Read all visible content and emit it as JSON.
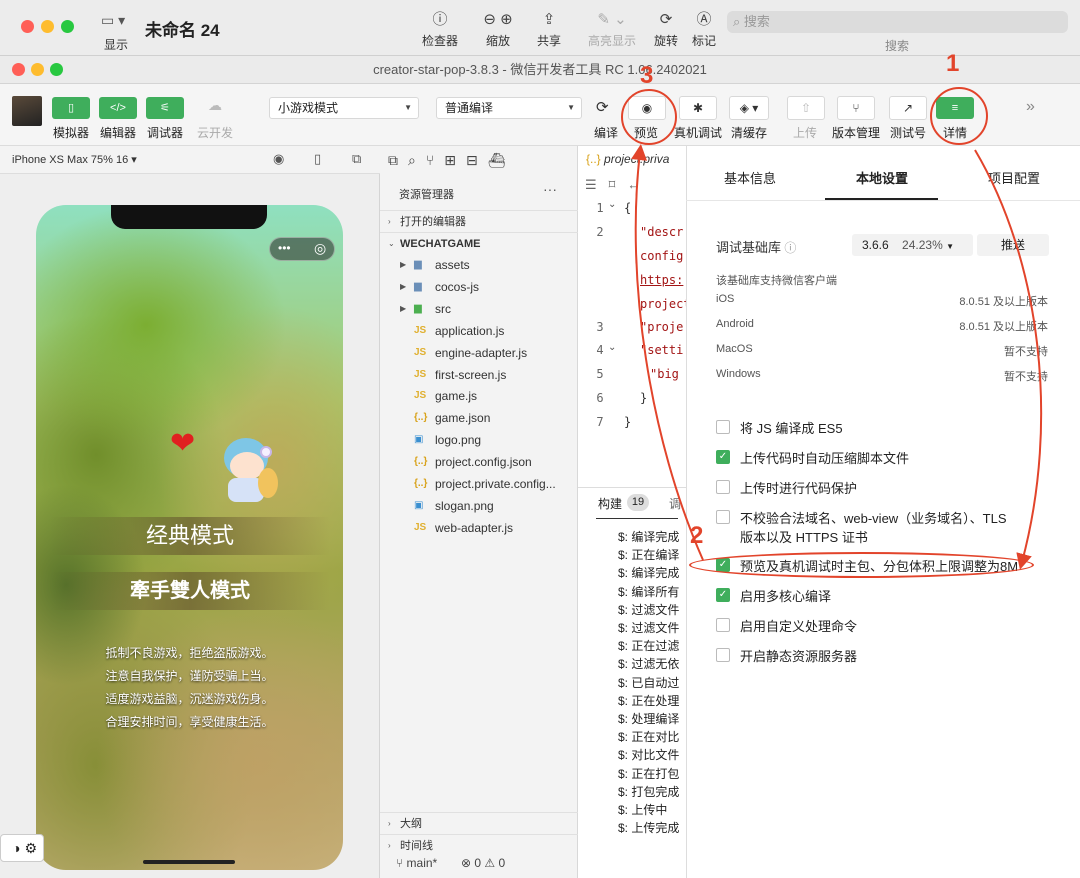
{
  "outer": {
    "display_label": "显示",
    "doc_title": "未命名 24",
    "toolbar": [
      "检查器",
      "缩放",
      "共享",
      "高亮显示",
      "旋转",
      "标记"
    ],
    "search_placeholder": "搜索",
    "search_label": "搜索"
  },
  "window_title": "creator-star-pop-3.8.3 - 微信开发者工具 RC 1.06.2402021",
  "toolbar": {
    "simulator": "模拟器",
    "editor": "编辑器",
    "debugger": "调试器",
    "cloud": "云开发",
    "mode_select": "小游戏模式",
    "compile_select": "普通编译",
    "compile": "编译",
    "preview": "预览",
    "real_debug": "真机调试",
    "clear_cache": "清缓存",
    "upload": "上传",
    "version_mgmt": "版本管理",
    "test_account": "测试号",
    "details": "详情"
  },
  "simulator": {
    "device": "iPhone XS Max 75% 16 ▾",
    "classic_mode": "经典模式",
    "duo_mode": "牽手雙人模式",
    "notice": [
      "抵制不良游戏，拒绝盗版游戏。",
      "注意自我保护，谨防受骗上当。",
      "适度游戏益脑，沉迷游戏伤身。",
      "合理安排时间，享受健康生活。"
    ]
  },
  "explorer": {
    "title": "资源管理器",
    "open_editors": "打开的编辑器",
    "project": "WECHATGAME",
    "items": [
      {
        "name": "assets",
        "type": "folder"
      },
      {
        "name": "cocos-js",
        "type": "folder"
      },
      {
        "name": "src",
        "type": "folder"
      },
      {
        "name": "application.js",
        "type": "js"
      },
      {
        "name": "engine-adapter.js",
        "type": "js"
      },
      {
        "name": "first-screen.js",
        "type": "js"
      },
      {
        "name": "game.js",
        "type": "js"
      },
      {
        "name": "game.json",
        "type": "json"
      },
      {
        "name": "logo.png",
        "type": "png"
      },
      {
        "name": "project.config.json",
        "type": "json"
      },
      {
        "name": "project.private.config...",
        "type": "json"
      },
      {
        "name": "slogan.png",
        "type": "png"
      },
      {
        "name": "web-adapter.js",
        "type": "js"
      }
    ],
    "outline": "大纲",
    "timeline": "时间线",
    "branch": "main*",
    "status": "⊗ 0 ⚠ 0"
  },
  "editor": {
    "tab": "project.priva",
    "line_numbers": [
      "1",
      "2",
      "",
      "",
      "",
      "3",
      "4",
      "5",
      "6",
      "7"
    ],
    "code": [
      "{",
      "\"descr",
      "config",
      "https:",
      "project",
      "\"proje",
      "\"setti",
      "\"big",
      "}",
      "}"
    ]
  },
  "console": {
    "tab_build": "构建",
    "build_count": "19",
    "tab_debug": "调",
    "lines": [
      "$: 编译完成",
      "$: 正在编译",
      "$: 编译完成",
      "$: 编译所有",
      "$: 过滤文件",
      "$: 过滤文件",
      "$: 正在过滤",
      "$: 过滤无依",
      "$: 已自动过",
      "$: 正在处理",
      "$: 处理编译",
      "$: 正在对比",
      "$: 对比文件",
      "$: 正在打包",
      "$: 打包完成",
      "$: 上传中",
      "$: 上传完成"
    ]
  },
  "details": {
    "tabs": [
      "基本信息",
      "本地设置",
      "项目配置"
    ],
    "lib_label": "调试基础库",
    "lib_version": "3.6.6",
    "lib_percent": "24.23%",
    "push_button": "推送",
    "support_note": "该基础库支持微信客户端",
    "platforms": [
      {
        "name": "iOS",
        "value": "8.0.51 及以上版本"
      },
      {
        "name": "Android",
        "value": "8.0.51 及以上版本"
      },
      {
        "name": "MacOS",
        "value": "暂不支持"
      },
      {
        "name": "Windows",
        "value": "暂不支持"
      }
    ],
    "options": [
      {
        "label": "将 JS 编译成 ES5",
        "checked": false
      },
      {
        "label": "上传代码时自动压缩脚本文件",
        "checked": true
      },
      {
        "label": "上传时进行代码保护",
        "checked": false
      },
      {
        "label": "不校验合法域名、web-view（业务域名）、TLS",
        "label2": "版本以及 HTTPS 证书",
        "checked": false
      },
      {
        "label": "预览及真机调试时主包、分包体积上限调整为8M",
        "checked": true
      },
      {
        "label": "启用多核心编译",
        "checked": true
      },
      {
        "label": "启用自定义处理命令",
        "checked": false
      },
      {
        "label": "开启静态资源服务器",
        "checked": false
      }
    ]
  },
  "annotations": [
    "1",
    "2",
    "3"
  ],
  "colors": {
    "accent_green": "#3fae5c",
    "annotation_red": "#e2442b"
  }
}
